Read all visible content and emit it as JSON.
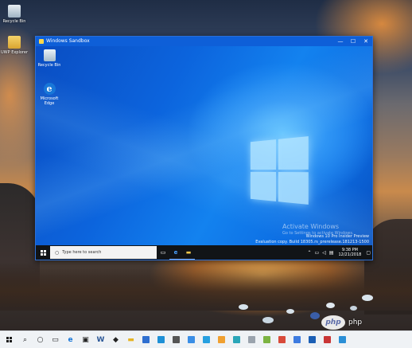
{
  "host": {
    "desktop_icons": [
      {
        "label": "Recycle Bin",
        "icon": "recycle-bin-icon"
      },
      {
        "label": "UWP Explorer",
        "icon": "folder-icon"
      }
    ],
    "taskbar": {
      "icons": [
        "windows-start-icon",
        "search-icon",
        "cortana-icon",
        "task-view-icon",
        "edge-icon",
        "store-icon",
        "word-icon",
        "mail-icon",
        "file-explorer-icon",
        "taskbar-app-1-icon",
        "taskbar-app-2-icon",
        "taskbar-app-3-icon",
        "taskbar-app-4-icon",
        "taskbar-app-5-icon",
        "taskbar-app-6-icon",
        "taskbar-app-7-icon",
        "taskbar-app-8-icon",
        "taskbar-app-9-icon",
        "taskbar-app-10-icon",
        "taskbar-app-11-icon",
        "taskbar-app-12-icon",
        "taskbar-app-13-icon",
        "taskbar-app-14-icon"
      ]
    }
  },
  "sandbox": {
    "title": "Windows Sandbox",
    "controls": {
      "minimize": "—",
      "maximize": "☐",
      "close": "✕"
    },
    "desktop_icons": [
      {
        "label": "Recycle Bin",
        "icon": "recycle-bin-icon"
      },
      {
        "label": "Microsoft Edge",
        "icon": "edge-icon"
      }
    ],
    "watermark": {
      "line1": "Activate Windows",
      "line2": "Go to Settings to activate Windows.",
      "line3": "Windows 10 Pro Insider Preview",
      "line4": "Evaluation copy. Build 18305.rs_prerelease.181213-1500"
    },
    "taskbar": {
      "search_placeholder": "Type here to search",
      "clock_time": "9:38 PM",
      "clock_date": "12/21/2018"
    }
  },
  "overlay": {
    "php_text": "php",
    "php_logo": "php"
  },
  "colors": {
    "sandbox_accent": "#0e5fd8",
    "taskbar_dark": "#111417",
    "host_taskbar": "#eff2f5"
  }
}
